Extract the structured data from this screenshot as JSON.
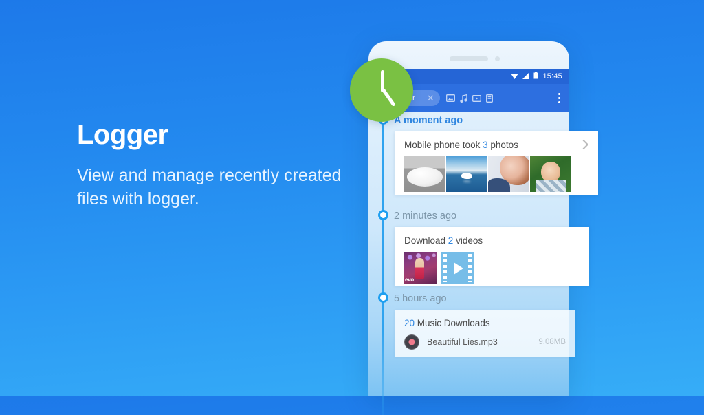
{
  "brand": {
    "accent_blue": "#2f86e0",
    "badge_green": "#7ac143",
    "toolbar_blue": "#2d6fe0",
    "statusbar_blue": "#2565d6"
  },
  "copy": {
    "title": "Logger",
    "subtitle": "View and manage recently created files with logger."
  },
  "phone": {
    "statusbar": {
      "time": "15:45",
      "icons": [
        "wifi-icon",
        "signal-icon",
        "battery-icon"
      ]
    },
    "toolbar": {
      "chip_label": "Logger",
      "chip_icon": "clock-icon",
      "chip_close_icon": "close-icon",
      "filter_icons": [
        "image-filter-icon",
        "music-filter-icon",
        "video-filter-icon",
        "document-filter-icon"
      ],
      "overflow_icon": "overflow-menu-icon"
    },
    "feed": {
      "groups": [
        {
          "time_label": "A moment ago",
          "card": {
            "title_prefix": "Mobile phone took ",
            "title_count": "3",
            "title_suffix": " photos",
            "chevron_icon": "chevron-right-icon",
            "thumbnails": [
              "plate-photo",
              "swan-photo",
              "portrait-photo",
              "child-photo"
            ]
          }
        },
        {
          "time_label": "2 minutes ago",
          "card": {
            "title_prefix": "Download ",
            "title_count": "2",
            "title_suffix": " videos",
            "thumbnails": [
              "concert-video-thumb",
              "video-placeholder-thumb"
            ],
            "watermark": "evo"
          }
        },
        {
          "time_label": "5 hours ago",
          "card": {
            "title_count": "20",
            "title_suffix": " Music Downloads",
            "file_icon": "vinyl-record-icon",
            "file_name": "Beautiful Lies.mp3",
            "file_size": "9.08MB"
          }
        }
      ]
    }
  },
  "app_badge": {
    "icon": "clock-icon"
  }
}
